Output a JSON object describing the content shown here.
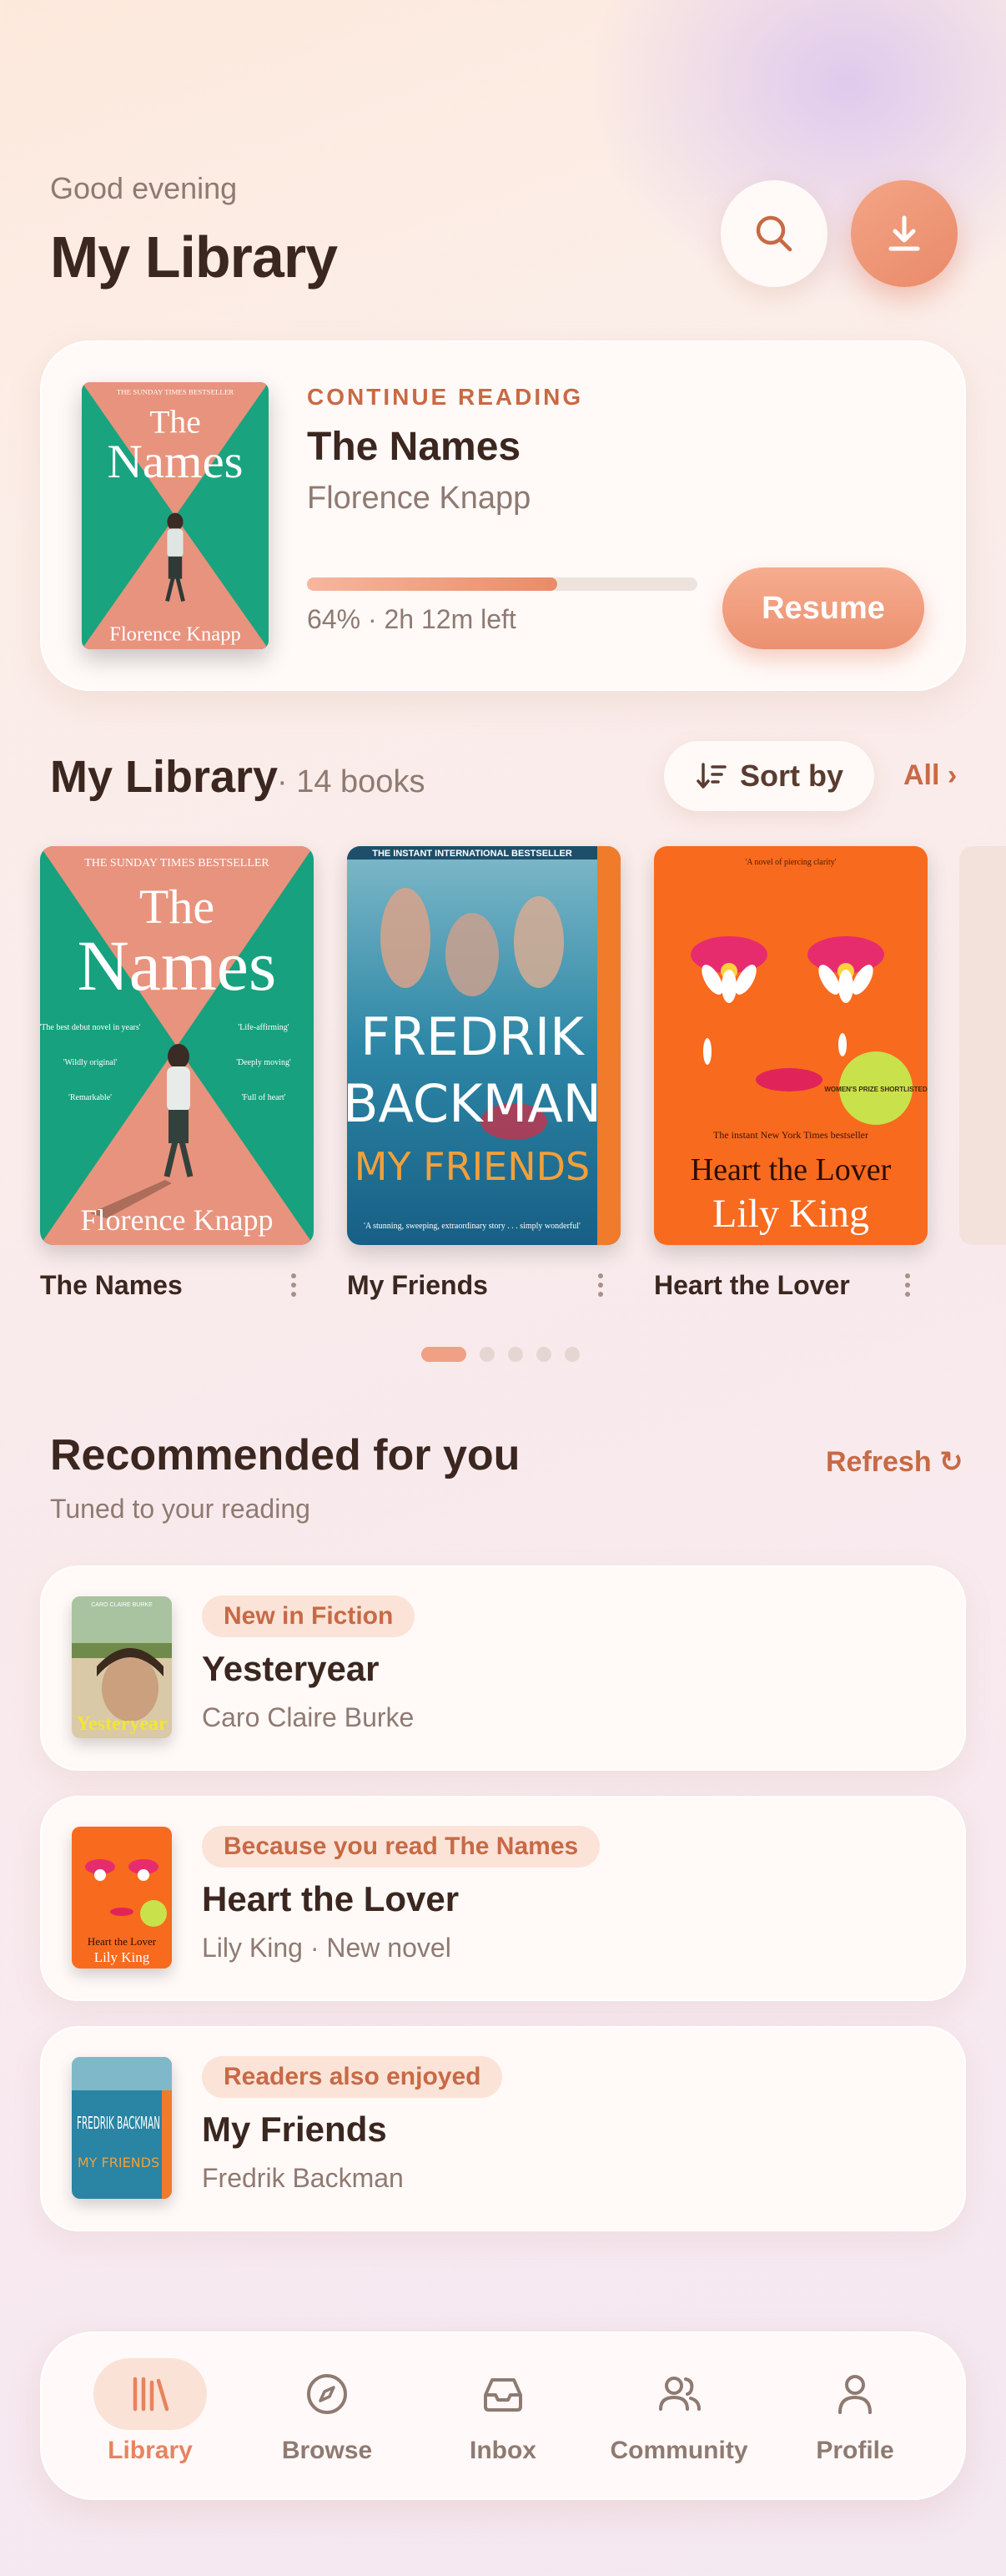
{
  "colors": {
    "accent": "#e98a6a",
    "accent_text": "#c76a45",
    "text": "#3b2620",
    "muted": "#8f7a72"
  },
  "header": {
    "greeting": "Good evening",
    "title": "My Library",
    "search_icon": "search-icon",
    "download_icon": "download-icon"
  },
  "continue_reading": {
    "kicker": "CONTINUE READING",
    "title": "The Names",
    "author": "Florence Knapp",
    "progress": 0.64,
    "meta": "64% · 2h 12m left",
    "resume_label": "Resume",
    "cover": {
      "banner": "THE SUNDAY TIMES BESTSELLER",
      "title_line1": "The",
      "title_line2": "Names",
      "author": "Florence Knapp"
    }
  },
  "library": {
    "title": "My Library",
    "count": "· 14 books",
    "sort_label": "Sort by",
    "all_label": "All ›",
    "books": [
      {
        "label": "The Names",
        "cover": {
          "banner": "THE SUNDAY TIMES BESTSELLER",
          "title_line1": "The",
          "title_line2": "Names",
          "author": "Florence Knapp",
          "blurb_left": [
            "'The best debut novel in years'",
            "'Wildly original'",
            "'Remarkable'"
          ],
          "blurb_right": [
            "'Life-affirming'",
            "'Deeply moving'",
            "'Full of heart'"
          ]
        }
      },
      {
        "label": "My Friends",
        "cover": {
          "banner": "THE INSTANT INTERNATIONAL BESTSELLER",
          "author_line1": "FREDRIK",
          "author_line2": "BACKMAN",
          "title": "MY FRIENDS",
          "quote": "'A stunning, sweeping, extraordinary story . . . simply wonderful'"
        }
      },
      {
        "label": "Heart the Lover",
        "cover": {
          "top_quote": "'A novel of piercing clarity'",
          "tagline": "The instant New York Times bestseller",
          "title": "Heart the Lover",
          "author": "Lily King",
          "sticker": "WOMEN'S PRIZE SHORTLISTED"
        }
      }
    ],
    "carousel_pages": 5,
    "carousel_active": 0
  },
  "recommended": {
    "title": "Recommended for you",
    "subtitle": "Tuned to your reading",
    "refresh_label": "Refresh ↻",
    "items": [
      {
        "badge": "New in Fiction",
        "title": "Yesteryear",
        "subtitle": "Caro Claire Burke",
        "cover_title": "Yesteryear",
        "cover_author": "CARO CLAIRE BURKE"
      },
      {
        "badge": "Because you read The Names",
        "title": "Heart the Lover",
        "subtitle": "Lily King · New novel",
        "cover_title": "Heart the Lover",
        "cover_author": "Lily King"
      },
      {
        "badge": "Readers also enjoyed",
        "title": "My Friends",
        "subtitle": "Fredrik Backman",
        "cover_title": "MY FRIENDS",
        "cover_author": "FREDRIK BACKMAN"
      }
    ]
  },
  "nav": {
    "items": [
      {
        "label": "Library",
        "icon": "library-icon",
        "active": true
      },
      {
        "label": "Browse",
        "icon": "compass-icon",
        "active": false
      },
      {
        "label": "Inbox",
        "icon": "inbox-icon",
        "active": false
      },
      {
        "label": "Community",
        "icon": "community-icon",
        "active": false
      },
      {
        "label": "Profile",
        "icon": "profile-icon",
        "active": false
      }
    ]
  }
}
